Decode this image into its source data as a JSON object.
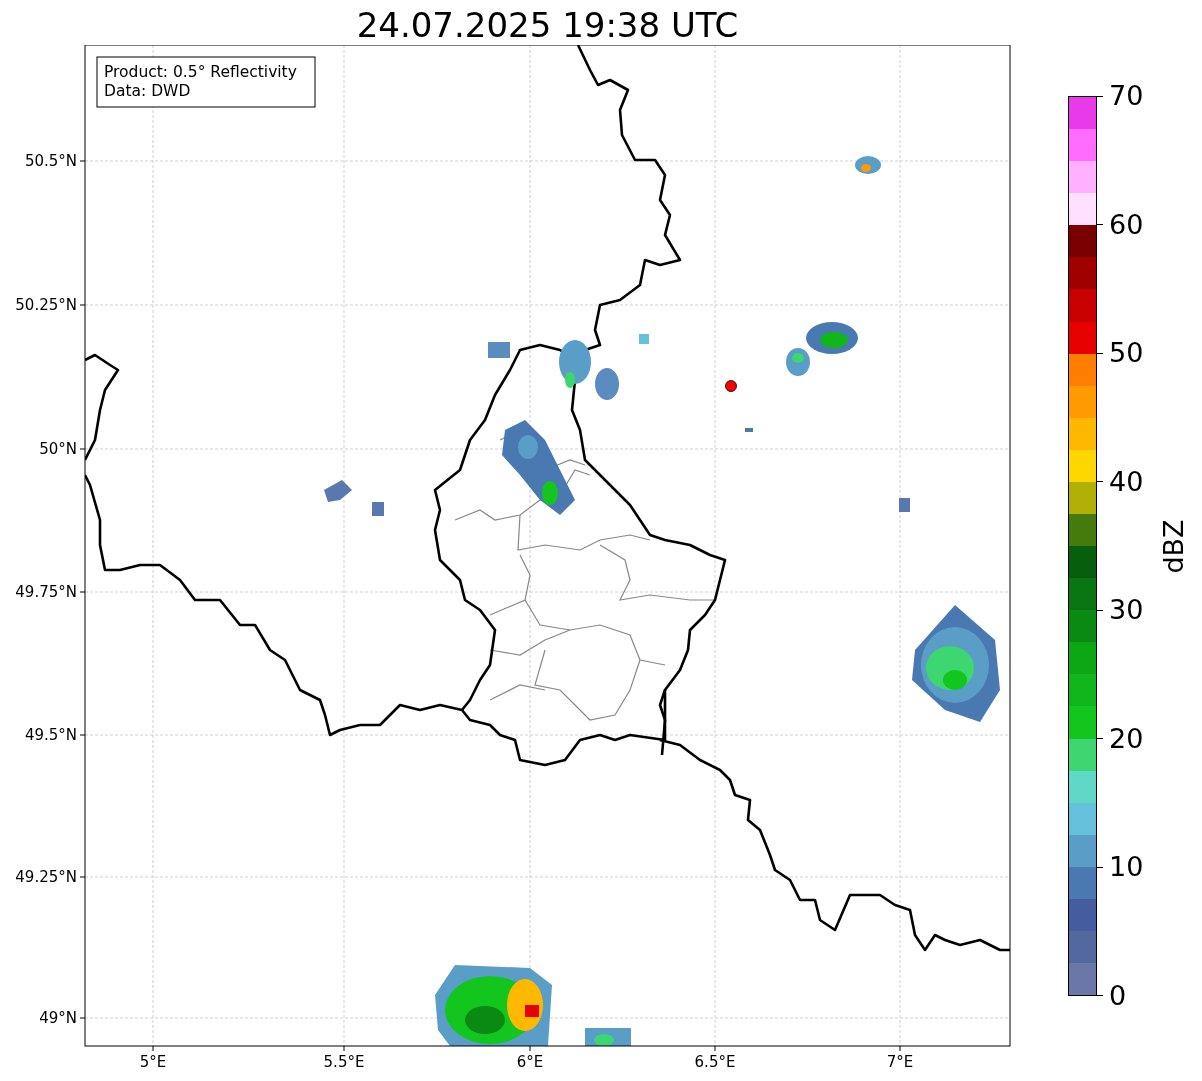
{
  "title": "24.07.2025 19:38 UTC",
  "info_box": {
    "lines": [
      "Product: 0.5° Reflectivity",
      "Data: DWD"
    ]
  },
  "map": {
    "lat_ticks": [
      "50.5°N",
      "50.25°N",
      "50°N",
      "49.75°N",
      "49.5°N",
      "49.25°N",
      "49°N"
    ],
    "lon_ticks": [
      "5°E",
      "5.5°E",
      "6°E",
      "6.5°E",
      "7°E"
    ]
  },
  "colorbar": {
    "label": "dBZ",
    "ticks": [
      "70",
      "60",
      "50",
      "40",
      "30",
      "20",
      "10",
      "0"
    ],
    "bins": [
      {
        "color": "#e83ae8"
      },
      {
        "color": "#ff6cff"
      },
      {
        "color": "#ffb0ff"
      },
      {
        "color": "#ffe0ff"
      },
      {
        "color": "#780000"
      },
      {
        "color": "#a00000"
      },
      {
        "color": "#c80000"
      },
      {
        "color": "#e60000"
      },
      {
        "color": "#ff7d00"
      },
      {
        "color": "#ff9a00"
      },
      {
        "color": "#ffb800"
      },
      {
        "color": "#ffd700"
      },
      {
        "color": "#b0b005"
      },
      {
        "color": "#457a0d"
      },
      {
        "color": "#075f0e"
      },
      {
        "color": "#0a7612"
      },
      {
        "color": "#0b8a13"
      },
      {
        "color": "#0da716"
      },
      {
        "color": "#0fb51a"
      },
      {
        "color": "#12c61e"
      },
      {
        "color": "#3dd670"
      },
      {
        "color": "#60d8c8"
      },
      {
        "color": "#65c0dc"
      },
      {
        "color": "#5a9ec8"
      },
      {
        "color": "#4a78b0"
      },
      {
        "color": "#455d9e"
      },
      {
        "color": "#5468a0"
      },
      {
        "color": "#6a77a8"
      }
    ]
  }
}
